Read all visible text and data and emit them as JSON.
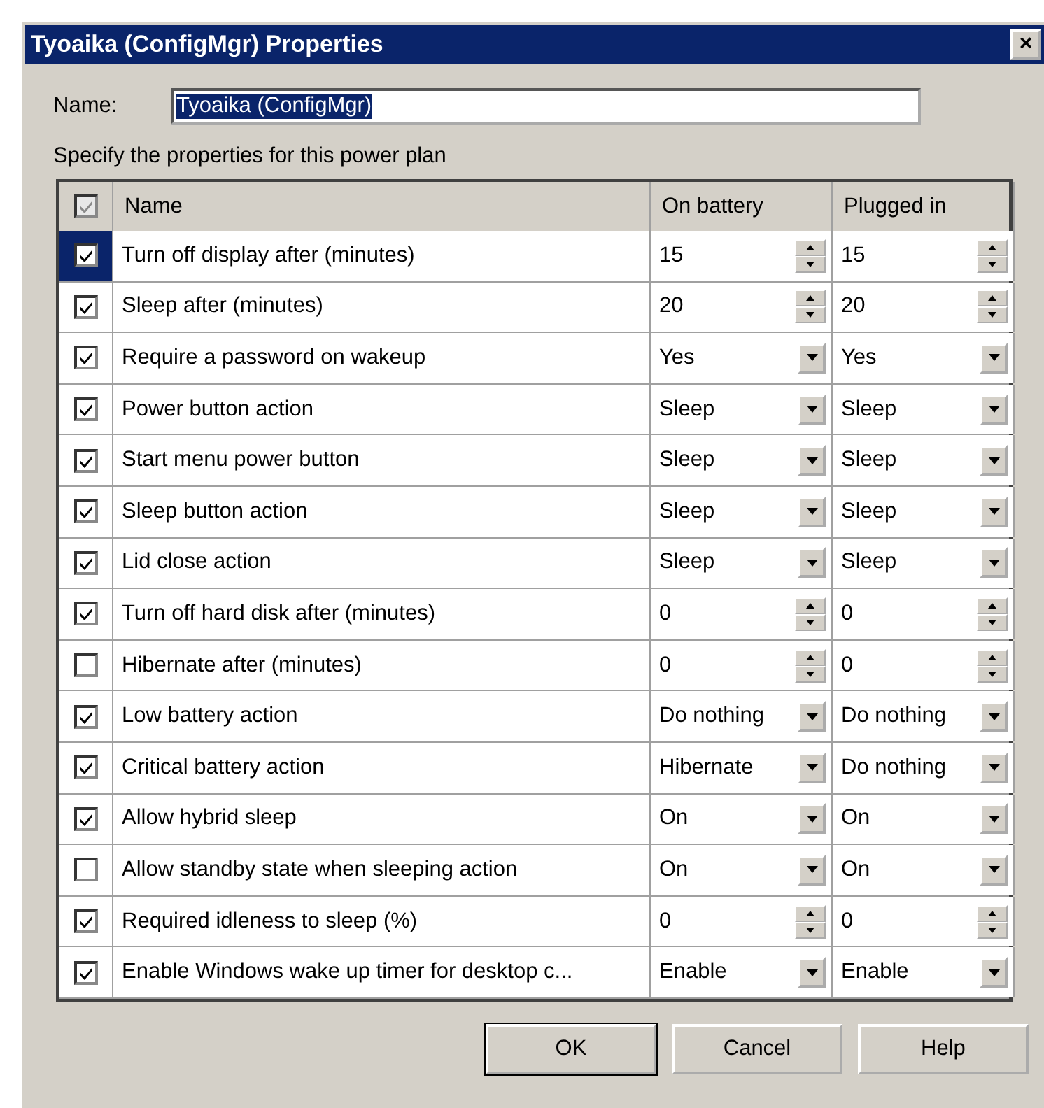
{
  "window": {
    "title": "Tyoaika (ConfigMgr) Properties",
    "close": "×"
  },
  "name_field": {
    "label": "Name:",
    "value": "Tyoaika (ConfigMgr)"
  },
  "instructions": "Specify the properties for this power plan",
  "table": {
    "header_checked": true,
    "columns": [
      "Name",
      "On battery",
      "Plugged in"
    ],
    "rows": [
      {
        "checked": true,
        "selected": true,
        "name": "Turn off display after (minutes)",
        "kind": "spin",
        "on_battery": "15",
        "plugged_in": "15"
      },
      {
        "checked": true,
        "selected": false,
        "name": "Sleep after (minutes)",
        "kind": "spin",
        "on_battery": "20",
        "plugged_in": "20"
      },
      {
        "checked": true,
        "selected": false,
        "name": "Require a password on wakeup",
        "kind": "dropdown",
        "on_battery": "Yes",
        "plugged_in": "Yes"
      },
      {
        "checked": true,
        "selected": false,
        "name": "Power button action",
        "kind": "dropdown",
        "on_battery": "Sleep",
        "plugged_in": "Sleep"
      },
      {
        "checked": true,
        "selected": false,
        "name": "Start menu power button",
        "kind": "dropdown",
        "on_battery": "Sleep",
        "plugged_in": "Sleep"
      },
      {
        "checked": true,
        "selected": false,
        "name": "Sleep button action",
        "kind": "dropdown",
        "on_battery": "Sleep",
        "plugged_in": "Sleep"
      },
      {
        "checked": true,
        "selected": false,
        "name": "Lid close action",
        "kind": "dropdown",
        "on_battery": "Sleep",
        "plugged_in": "Sleep"
      },
      {
        "checked": true,
        "selected": false,
        "name": "Turn off hard disk after (minutes)",
        "kind": "spin",
        "on_battery": "0",
        "plugged_in": "0"
      },
      {
        "checked": false,
        "selected": false,
        "name": "Hibernate after (minutes)",
        "kind": "spin",
        "on_battery": "0",
        "plugged_in": "0"
      },
      {
        "checked": true,
        "selected": false,
        "name": "Low battery action",
        "kind": "dropdown",
        "on_battery": "Do nothing",
        "plugged_in": "Do nothing"
      },
      {
        "checked": true,
        "selected": false,
        "name": "Critical battery action",
        "kind": "dropdown",
        "on_battery": "Hibernate",
        "plugged_in": "Do nothing"
      },
      {
        "checked": true,
        "selected": false,
        "name": "Allow hybrid sleep",
        "kind": "dropdown",
        "on_battery": "On",
        "plugged_in": "On"
      },
      {
        "checked": false,
        "selected": false,
        "name": "Allow standby state when sleeping action",
        "kind": "dropdown",
        "on_battery": "On",
        "plugged_in": "On"
      },
      {
        "checked": true,
        "selected": false,
        "name": "Required idleness to sleep (%)",
        "kind": "spin",
        "on_battery": "0",
        "plugged_in": "0"
      },
      {
        "checked": true,
        "selected": false,
        "name": "Enable Windows wake up timer for desktop c...",
        "kind": "dropdown",
        "on_battery": "Enable",
        "plugged_in": "Enable"
      }
    ]
  },
  "buttons": [
    {
      "label": "OK",
      "default": true
    },
    {
      "label": "Cancel",
      "default": false
    },
    {
      "label": "Help",
      "default": false
    }
  ]
}
